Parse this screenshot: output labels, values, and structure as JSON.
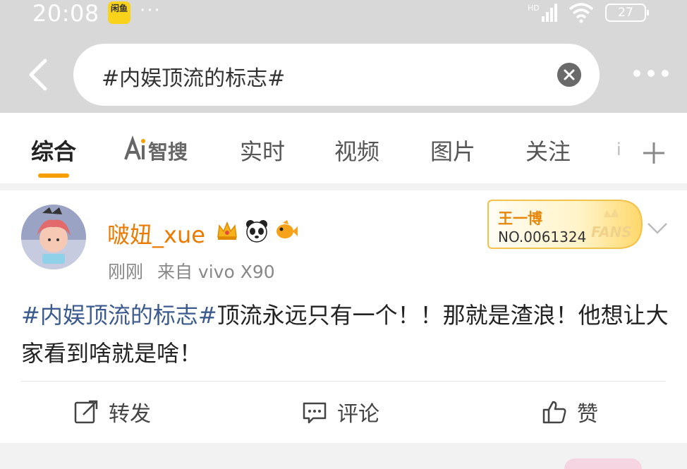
{
  "status_bar": {
    "time": "20:08",
    "app_badge": "闲鱼",
    "dots": "···",
    "network": "HD",
    "battery": "27"
  },
  "search": {
    "query": "#内娱顶流的标志#"
  },
  "tabs": [
    {
      "label": "综合",
      "active": true
    },
    {
      "label": "Ai智搜",
      "active": false
    },
    {
      "label": "实时",
      "active": false
    },
    {
      "label": "视频",
      "active": false
    },
    {
      "label": "图片",
      "active": false
    },
    {
      "label": "关注",
      "active": false
    }
  ],
  "tabs_overflow": "i",
  "post": {
    "username": "啵妞_xue",
    "time": "刚刚",
    "source": "来自 vivo X90",
    "fans_badge": {
      "name": "王一博",
      "number": "NO.0061324",
      "label": "FANS"
    },
    "hashtag": "#内娱顶流的标志#",
    "text": "顶流永远只有一个！！那就是渣浪！他想让大家看到啥就是啥！",
    "actions": {
      "repost": "转发",
      "comment": "评论",
      "like": "赞"
    }
  },
  "colors": {
    "accent": "#f6a000",
    "username": "#eb7a00",
    "hashtag": "#3b5a8e",
    "header_bg": "#d8d8d8"
  }
}
